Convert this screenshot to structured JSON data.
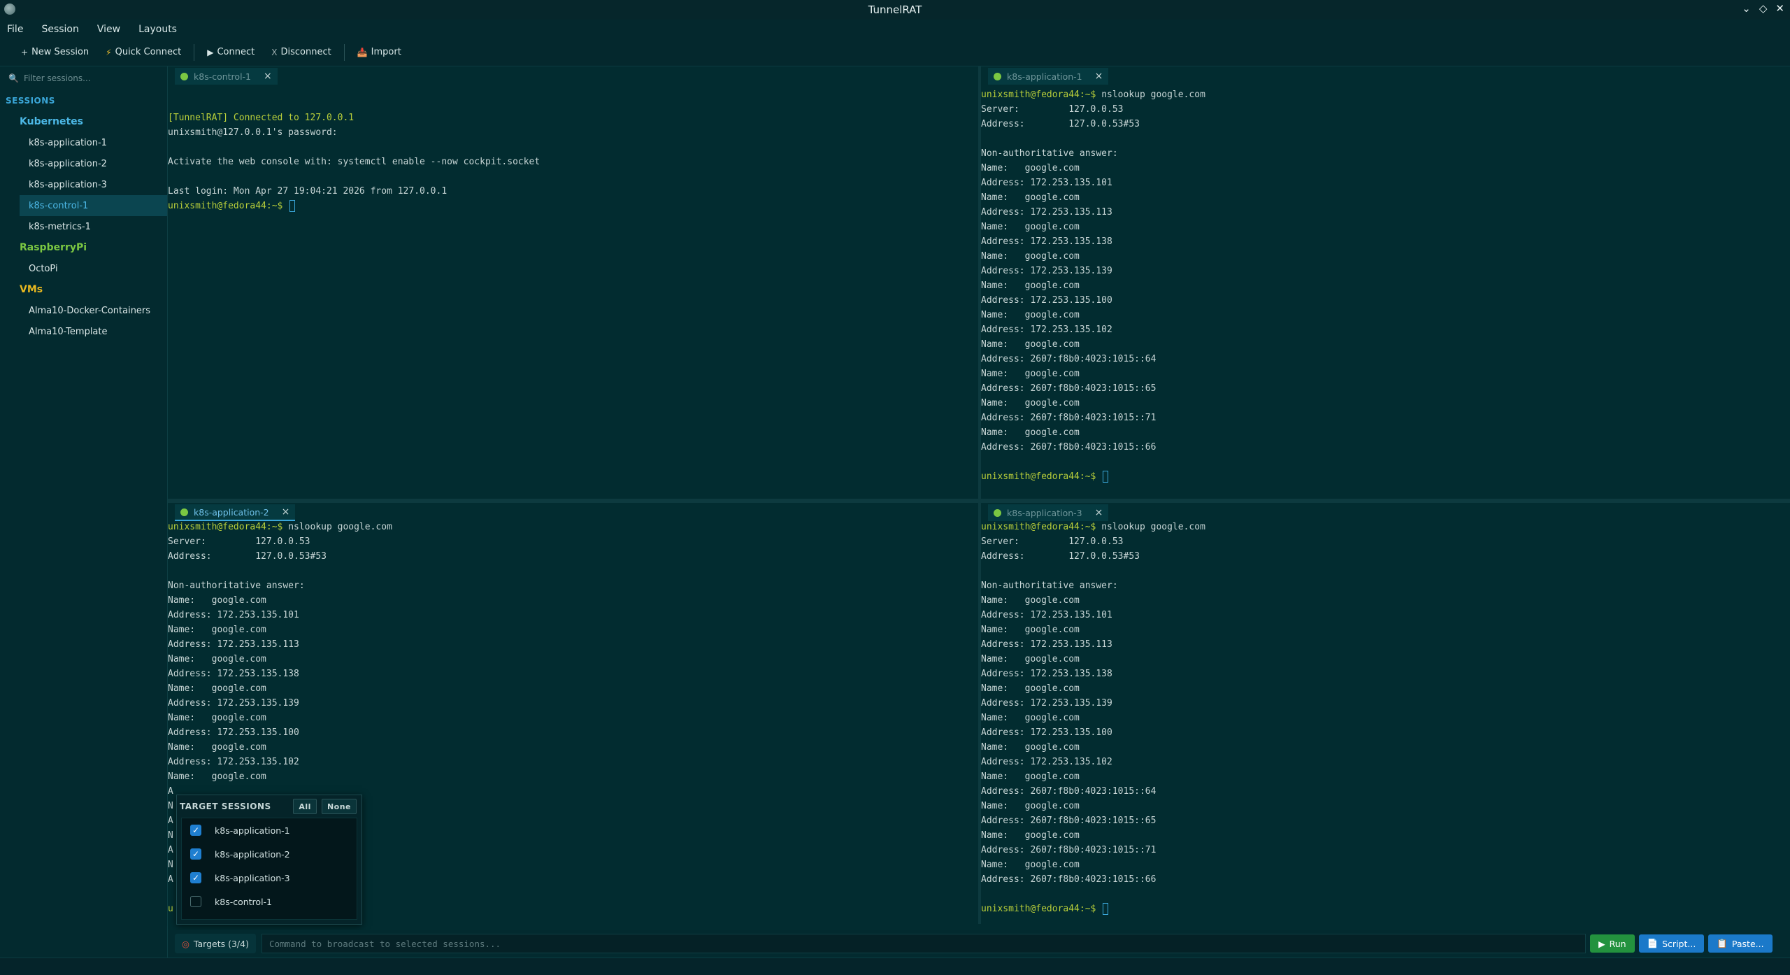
{
  "window": {
    "title": "TunnelRAT",
    "controls": [
      "⌄",
      "◇",
      "✕"
    ]
  },
  "menu": [
    "File",
    "Session",
    "View",
    "Layouts"
  ],
  "toolbar": {
    "new_session": "New Session",
    "quick_connect": "Quick Connect",
    "connect": "Connect",
    "disconnect": "Disconnect",
    "import": "Import"
  },
  "sidebar": {
    "filter_placeholder": "Filter sessions...",
    "header": "SESSIONS",
    "groups": [
      {
        "name": "Kubernetes",
        "color": "#4cb8e6",
        "items": [
          "k8s-application-1",
          "k8s-application-2",
          "k8s-application-3",
          "k8s-control-1",
          "k8s-metrics-1"
        ]
      },
      {
        "name": "RaspberryPi",
        "color": "#7bc742",
        "items": [
          "OctoPi"
        ]
      },
      {
        "name": "VMs",
        "color": "#e8b820",
        "items": [
          "Alma10-Docker-Containers",
          "Alma10-Template"
        ]
      }
    ],
    "selected": "k8s-control-1"
  },
  "panes": [
    {
      "tab": "k8s-control-1",
      "active": false,
      "lines": [
        {
          "t": "",
          "c": ""
        },
        {
          "t": "[TunnelRAT] Connected to 127.0.0.1",
          "c": "banner"
        },
        {
          "t": "unixsmith@127.0.0.1's password:",
          "c": ""
        },
        {
          "t": "",
          "c": ""
        },
        {
          "t": "Activate the web console with: systemctl enable --now cockpit.socket",
          "c": ""
        },
        {
          "t": "",
          "c": ""
        },
        {
          "t": "Last login: Mon Apr 27 19:04:21 2026 from 127.0.0.1",
          "c": ""
        }
      ],
      "prompt": "unixsmith@fedora44:~$ "
    },
    {
      "tab": "k8s-application-1",
      "active": false,
      "command_prompt": "unixsmith@fedora44:~$ ",
      "command": "nslookup google.com",
      "lines": [
        {
          "t": "Server:         127.0.0.53",
          "c": ""
        },
        {
          "t": "Address:        127.0.0.53#53",
          "c": ""
        },
        {
          "t": "",
          "c": ""
        },
        {
          "t": "Non-authoritative answer:",
          "c": ""
        },
        {
          "t": "Name:   google.com",
          "c": ""
        },
        {
          "t": "Address: 172.253.135.101",
          "c": ""
        },
        {
          "t": "Name:   google.com",
          "c": ""
        },
        {
          "t": "Address: 172.253.135.113",
          "c": ""
        },
        {
          "t": "Name:   google.com",
          "c": ""
        },
        {
          "t": "Address: 172.253.135.138",
          "c": ""
        },
        {
          "t": "Name:   google.com",
          "c": ""
        },
        {
          "t": "Address: 172.253.135.139",
          "c": ""
        },
        {
          "t": "Name:   google.com",
          "c": ""
        },
        {
          "t": "Address: 172.253.135.100",
          "c": ""
        },
        {
          "t": "Name:   google.com",
          "c": ""
        },
        {
          "t": "Address: 172.253.135.102",
          "c": ""
        },
        {
          "t": "Name:   google.com",
          "c": ""
        },
        {
          "t": "Address: 2607:f8b0:4023:1015::64",
          "c": ""
        },
        {
          "t": "Name:   google.com",
          "c": ""
        },
        {
          "t": "Address: 2607:f8b0:4023:1015::65",
          "c": ""
        },
        {
          "t": "Name:   google.com",
          "c": ""
        },
        {
          "t": "Address: 2607:f8b0:4023:1015::71",
          "c": ""
        },
        {
          "t": "Name:   google.com",
          "c": ""
        },
        {
          "t": "Address: 2607:f8b0:4023:1015::66",
          "c": ""
        },
        {
          "t": "",
          "c": ""
        }
      ],
      "prompt": "unixsmith@fedora44:~$ "
    },
    {
      "tab": "k8s-application-2",
      "active": true,
      "command_prompt": "unixsmith@fedora44:~$ ",
      "command": "nslookup google.com",
      "lines": [
        {
          "t": "Server:         127.0.0.53",
          "c": ""
        },
        {
          "t": "Address:        127.0.0.53#53",
          "c": ""
        },
        {
          "t": "",
          "c": ""
        },
        {
          "t": "Non-authoritative answer:",
          "c": ""
        },
        {
          "t": "Name:   google.com",
          "c": ""
        },
        {
          "t": "Address: 172.253.135.101",
          "c": ""
        },
        {
          "t": "Name:   google.com",
          "c": ""
        },
        {
          "t": "Address: 172.253.135.113",
          "c": ""
        },
        {
          "t": "Name:   google.com",
          "c": ""
        },
        {
          "t": "Address: 172.253.135.138",
          "c": ""
        },
        {
          "t": "Name:   google.com",
          "c": ""
        },
        {
          "t": "Address: 172.253.135.139",
          "c": ""
        },
        {
          "t": "Name:   google.com",
          "c": ""
        },
        {
          "t": "Address: 172.253.135.100",
          "c": ""
        },
        {
          "t": "Name:   google.com",
          "c": ""
        },
        {
          "t": "Address: 172.253.135.102",
          "c": ""
        },
        {
          "t": "Name:   google.com",
          "c": ""
        },
        {
          "t": "A",
          "c": ""
        },
        {
          "t": "N",
          "c": ""
        },
        {
          "t": "A",
          "c": ""
        },
        {
          "t": "N",
          "c": ""
        },
        {
          "t": "A",
          "c": ""
        },
        {
          "t": "N",
          "c": ""
        },
        {
          "t": "A",
          "c": ""
        },
        {
          "t": "",
          "c": ""
        }
      ],
      "prompt": "u"
    },
    {
      "tab": "k8s-application-3",
      "active": false,
      "command_prompt": "unixsmith@fedora44:~$ ",
      "command": "nslookup google.com",
      "lines": [
        {
          "t": "Server:         127.0.0.53",
          "c": ""
        },
        {
          "t": "Address:        127.0.0.53#53",
          "c": ""
        },
        {
          "t": "",
          "c": ""
        },
        {
          "t": "Non-authoritative answer:",
          "c": ""
        },
        {
          "t": "Name:   google.com",
          "c": ""
        },
        {
          "t": "Address: 172.253.135.101",
          "c": ""
        },
        {
          "t": "Name:   google.com",
          "c": ""
        },
        {
          "t": "Address: 172.253.135.113",
          "c": ""
        },
        {
          "t": "Name:   google.com",
          "c": ""
        },
        {
          "t": "Address: 172.253.135.138",
          "c": ""
        },
        {
          "t": "Name:   google.com",
          "c": ""
        },
        {
          "t": "Address: 172.253.135.139",
          "c": ""
        },
        {
          "t": "Name:   google.com",
          "c": ""
        },
        {
          "t": "Address: 172.253.135.100",
          "c": ""
        },
        {
          "t": "Name:   google.com",
          "c": ""
        },
        {
          "t": "Address: 172.253.135.102",
          "c": ""
        },
        {
          "t": "Name:   google.com",
          "c": ""
        },
        {
          "t": "Address: 2607:f8b0:4023:1015::64",
          "c": ""
        },
        {
          "t": "Name:   google.com",
          "c": ""
        },
        {
          "t": "Address: 2607:f8b0:4023:1015::65",
          "c": ""
        },
        {
          "t": "Name:   google.com",
          "c": ""
        },
        {
          "t": "Address: 2607:f8b0:4023:1015::71",
          "c": ""
        },
        {
          "t": "Name:   google.com",
          "c": ""
        },
        {
          "t": "Address: 2607:f8b0:4023:1015::66",
          "c": ""
        },
        {
          "t": "",
          "c": ""
        }
      ],
      "prompt": "unixsmith@fedora44:~$ "
    }
  ],
  "target_popup": {
    "title": "TARGET SESSIONS",
    "all_label": "All",
    "none_label": "None",
    "sessions": [
      {
        "name": "k8s-application-1",
        "checked": true
      },
      {
        "name": "k8s-application-2",
        "checked": true
      },
      {
        "name": "k8s-application-3",
        "checked": true
      },
      {
        "name": "k8s-control-1",
        "checked": false
      }
    ]
  },
  "broadcast": {
    "targets_label": "Targets (3/4)",
    "placeholder": "Command to broadcast to selected sessions...",
    "run_label": "Run",
    "script_label": "Script...",
    "paste_label": "Paste..."
  }
}
